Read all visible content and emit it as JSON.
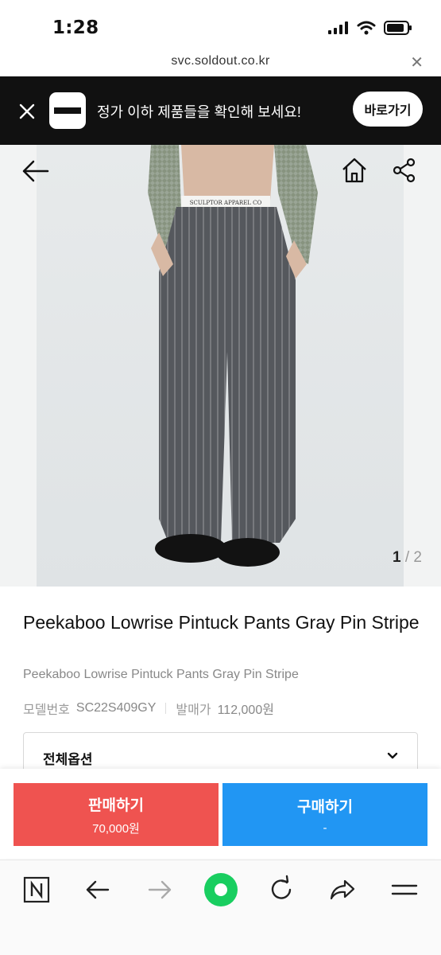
{
  "status_bar": {
    "time": "1:28"
  },
  "url_bar": {
    "url": "svc.soldout.co.kr",
    "close_glyph": "✕"
  },
  "banner": {
    "message": "정가 이하 제품들을 확인해 보세요!",
    "button_label": "바로가기"
  },
  "gallery": {
    "current": "1",
    "separator": " / ",
    "total": "2"
  },
  "product": {
    "title": "Peekaboo Lowrise Pintuck Pants Gray Pin Stripe",
    "subtitle": "Peekaboo Lowrise Pintuck Pants Gray Pin Stripe",
    "model_label": "모델번호",
    "model_value": "SC22S409GY",
    "release_label": "발매가",
    "release_value": "112,000원"
  },
  "options": {
    "label": "전체옵션"
  },
  "actions": {
    "sell_label": "판매하기",
    "sell_price": "70,000원",
    "buy_label": "구매하기",
    "buy_price": "-"
  },
  "colors": {
    "sell": "#ef5350",
    "buy": "#2196f3",
    "banner": "#111111",
    "naver_green": "#19ce60"
  },
  "icons": [
    "naver-icon",
    "back-arrow-icon",
    "forward-arrow-icon",
    "naver-green-button-icon",
    "refresh-icon",
    "share-icon",
    "menu-icon"
  ]
}
